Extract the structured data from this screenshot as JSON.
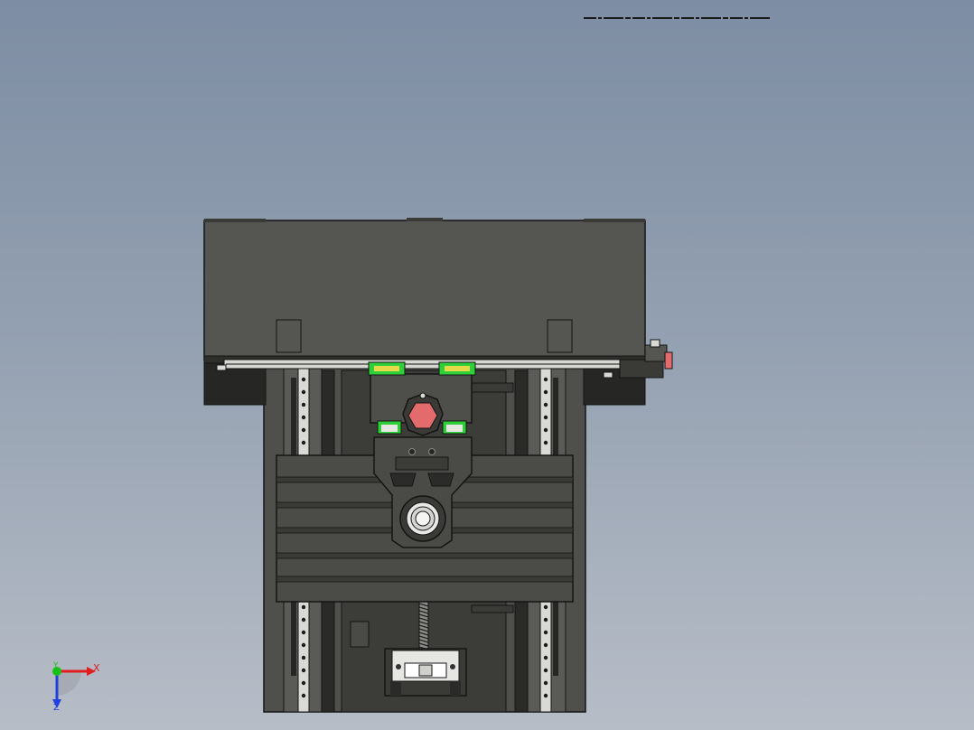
{
  "view": {
    "background_top": "#7d8da3",
    "background_bottom": "#b7bdc7",
    "body_color": "#555651",
    "edge_color": "#141414",
    "accent_green": "#2fcf3a",
    "accent_red": "#e46b6b",
    "accent_yellow": "#e6d94a"
  },
  "triad": {
    "x_label": "X",
    "y_label": "Y",
    "z_label": "Z",
    "x_color": "#e01e1e",
    "y_color": "#18c018",
    "z_color": "#2040e0"
  },
  "icons": {
    "triad": "axis-triad-icon",
    "toolbar_strip": "heads-up-toolbar-icon"
  }
}
